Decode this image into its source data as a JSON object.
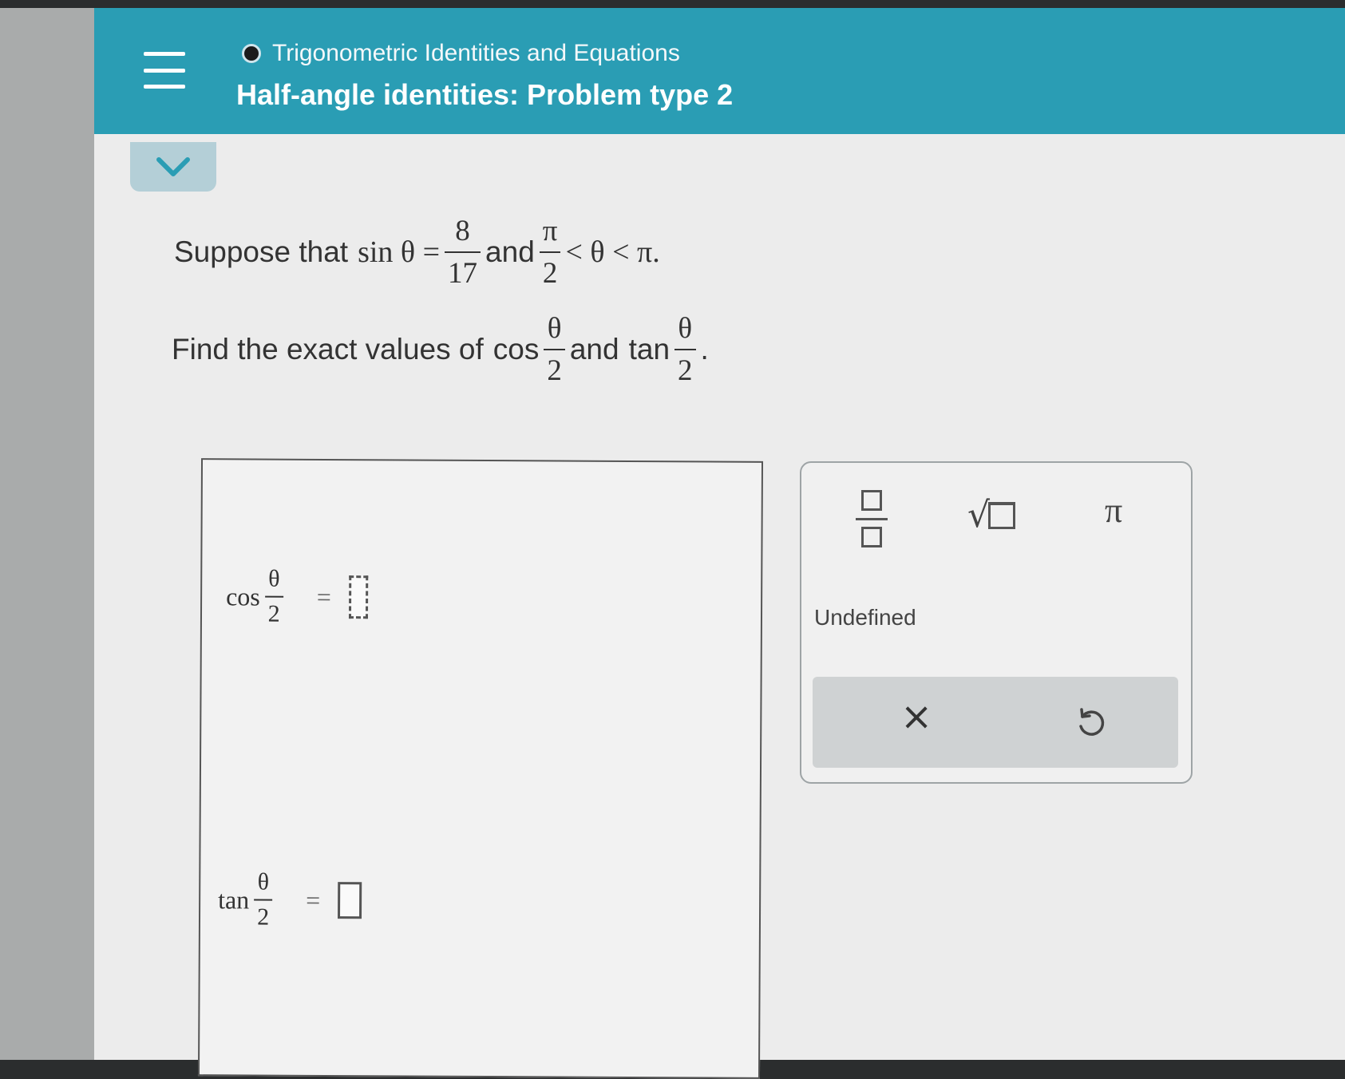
{
  "header": {
    "topic": "Trigonometric Identities and Equations",
    "title": "Half-angle identities: Problem type 2"
  },
  "problem": {
    "line1": {
      "prefix": "Suppose that",
      "sin_expr": "sin θ =",
      "frac1_num": "8",
      "frac1_den": "17",
      "and": "and",
      "frac2_num": "π",
      "frac2_den": "2",
      "ineq": "< θ < π."
    },
    "line2": {
      "prefix": "Find the exact values of",
      "cos": "cos",
      "theta": "θ",
      "two": "2",
      "and": "and",
      "tan": "tan",
      "end": "."
    }
  },
  "answers": {
    "cos_label": "cos",
    "tan_label": "tan",
    "theta": "θ",
    "two": "2",
    "equals": "="
  },
  "palette": {
    "pi": "π",
    "undefined": "Undefined",
    "clear": "×"
  },
  "colors": {
    "header_bg": "#2a9db4",
    "chevron_tab": "#b4cfd7"
  }
}
